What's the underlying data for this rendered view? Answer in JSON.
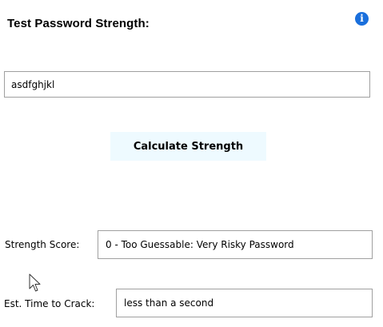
{
  "header": {
    "title": "Test Password Strength:",
    "info_icon": "info-icon"
  },
  "password_input": {
    "value": "asdfghjkl"
  },
  "calculate_button": {
    "label": "Calculate Strength"
  },
  "results": {
    "strength_label": "Strength Score:",
    "strength_value": "0 - Too Guessable: Very Risky Password",
    "time_label": "Est. Time to Crack:",
    "time_value": "less than a second"
  },
  "colors": {
    "info_icon": "#1a6fdc",
    "button_background": "#eefaff",
    "field_border": "#a0a0a0"
  },
  "icons": {
    "pointer": "mouse-pointer-icon"
  }
}
